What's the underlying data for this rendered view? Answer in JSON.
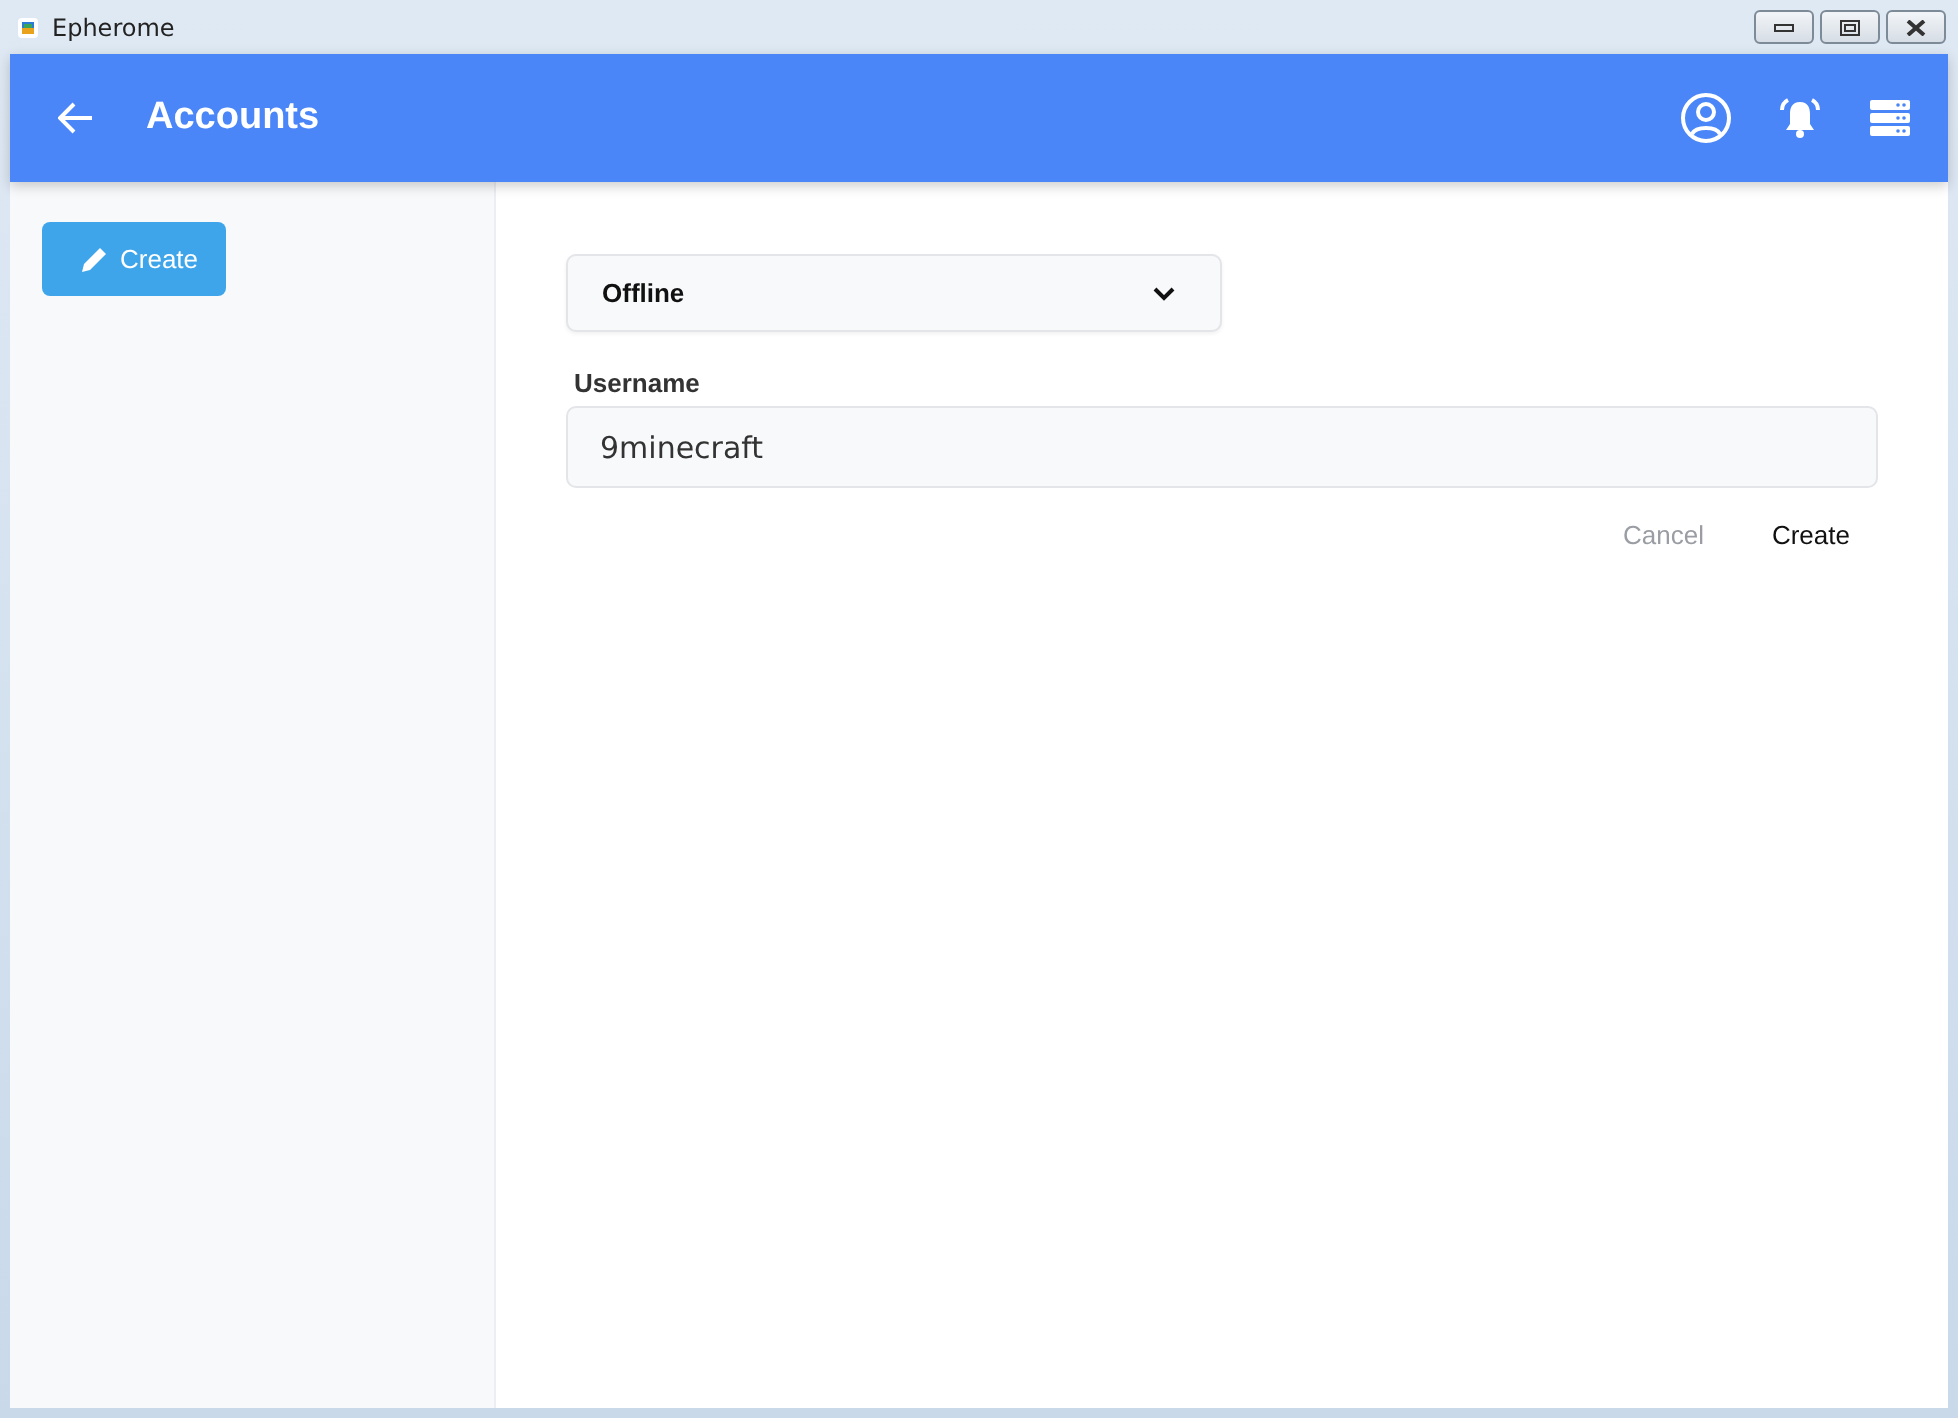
{
  "window": {
    "title": "Epherome"
  },
  "header": {
    "title": "Accounts"
  },
  "sidebar": {
    "create_button": "Create"
  },
  "form": {
    "account_type": "Offline",
    "username_label": "Username",
    "username_value": "9minecraft",
    "buttons": [
      {
        "label": "Cancel",
        "disabled": true
      },
      {
        "label": "Create",
        "disabled": false
      }
    ]
  }
}
